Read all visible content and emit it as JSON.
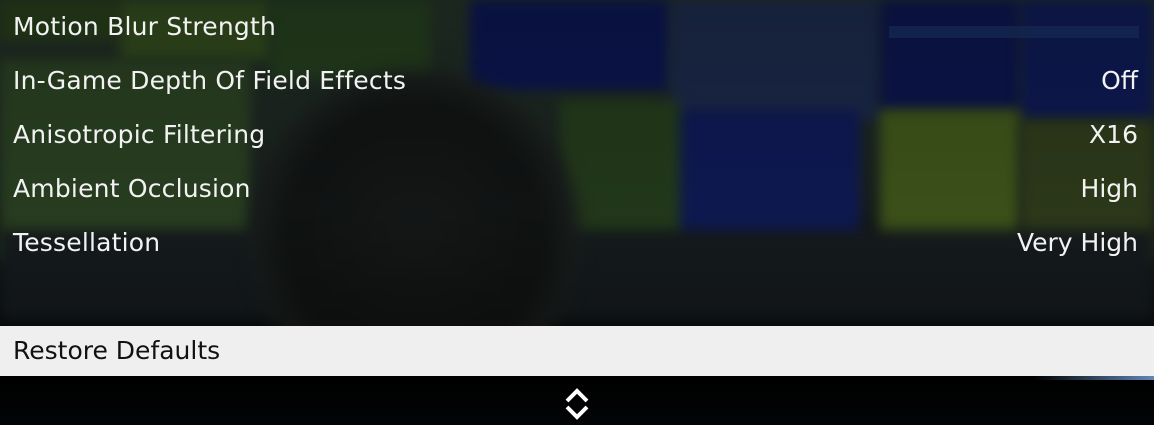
{
  "settings": [
    {
      "label": "Motion Blur Strength",
      "type": "slider",
      "value_fraction": 0.0
    },
    {
      "label": "In-Game Depth Of Field Effects",
      "type": "option",
      "value": "Off"
    },
    {
      "label": "Anisotropic Filtering",
      "type": "option",
      "value": "X16"
    },
    {
      "label": "Ambient Occlusion",
      "type": "option",
      "value": "High"
    },
    {
      "label": "Tessellation",
      "type": "option",
      "value": "Very High"
    }
  ],
  "restore_defaults": {
    "label": "Restore Defaults"
  },
  "footer": {
    "icon": "scroll-up-down-icon"
  },
  "colors": {
    "text": "#f2f2f2",
    "highlight_bg": "#efefef",
    "highlight_text": "#111111",
    "slider_track": "#142850",
    "slider_fill": "#2d4f8f"
  }
}
